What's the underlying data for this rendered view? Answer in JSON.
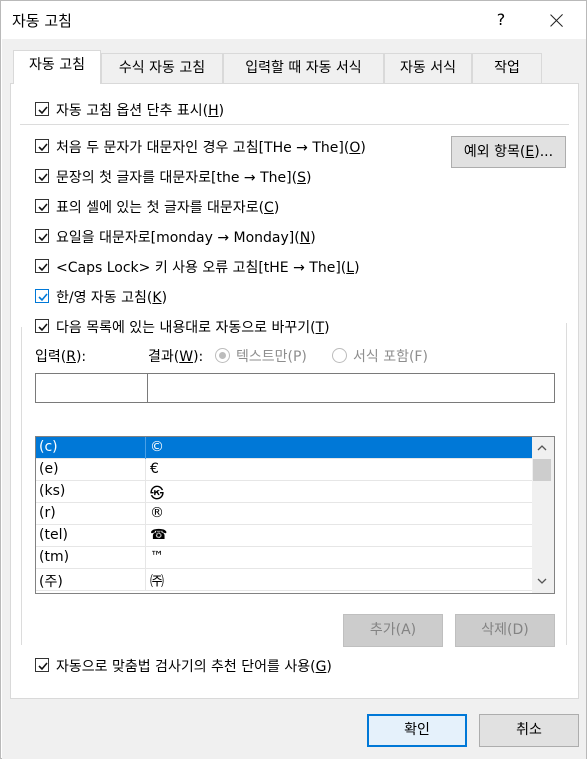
{
  "window": {
    "title": "자동 고침",
    "help": "?"
  },
  "tabs": [
    {
      "label": "자동 고침",
      "active": true
    },
    {
      "label": "수식 자동 고침"
    },
    {
      "label": "입력할 때 자동 서식"
    },
    {
      "label": "자동 서식"
    },
    {
      "label": "작업"
    }
  ],
  "options": {
    "show_buttons": {
      "text": "자동 고침 옵션 단추 표시",
      "key": "H",
      "checked": true
    },
    "two_initial_caps": {
      "text": "처음 두 문자가 대문자인 경우 고침[THe → The]",
      "key": "O",
      "checked": true
    },
    "sentence_caps": {
      "text": "문장의 첫 글자를 대문자로[the → The]",
      "key": "S",
      "checked": true
    },
    "table_cell_caps": {
      "text": "표의 셀에 있는 첫 글자를 대문자로",
      "key": "C",
      "checked": true
    },
    "day_names": {
      "text": "요일을 대문자로[monday → Monday]",
      "key": "N",
      "checked": true
    },
    "caps_lock": {
      "text": "<Caps Lock> 키 사용 오류 고침[tHE → The]",
      "key": "L",
      "checked": true
    },
    "hangul_english": {
      "text": "한/영 자동 고침",
      "key": "K",
      "checked": true
    },
    "replace_text": {
      "text": "다음 목록에 있는 내용대로 자동으로 바꾸기",
      "key": "T",
      "checked": true
    },
    "use_spellchecker": {
      "text": "자동으로 맞춤법 검사기의 추천 단어를 사용",
      "key": "G",
      "checked": true
    }
  },
  "exceptions_button": {
    "text": "예외 항목",
    "key": "E",
    "suffix": "..."
  },
  "replace": {
    "input_label": "입력",
    "input_key": "R",
    "result_label": "결과",
    "result_key": "W",
    "radio_plain": "텍스트만(P)",
    "radio_formatted": "서식 포함(F)",
    "input_value": "",
    "result_value": ""
  },
  "list": {
    "rows": [
      {
        "from": "(c)",
        "to": "©",
        "selected": true
      },
      {
        "from": "(e)",
        "to": "€"
      },
      {
        "from": "(ks)",
        "to": "㉿"
      },
      {
        "from": "(r)",
        "to": "®"
      },
      {
        "from": "(tel)",
        "to": "☎"
      },
      {
        "from": "(tm)",
        "to": "™"
      },
      {
        "from": "(주)",
        "to": "㈜"
      }
    ]
  },
  "buttons": {
    "add": "추가(A)",
    "delete": "삭제(D)",
    "ok": "확인",
    "cancel": "취소"
  },
  "colors": {
    "accent": "#0078d7",
    "disabled_text": "#838383"
  }
}
